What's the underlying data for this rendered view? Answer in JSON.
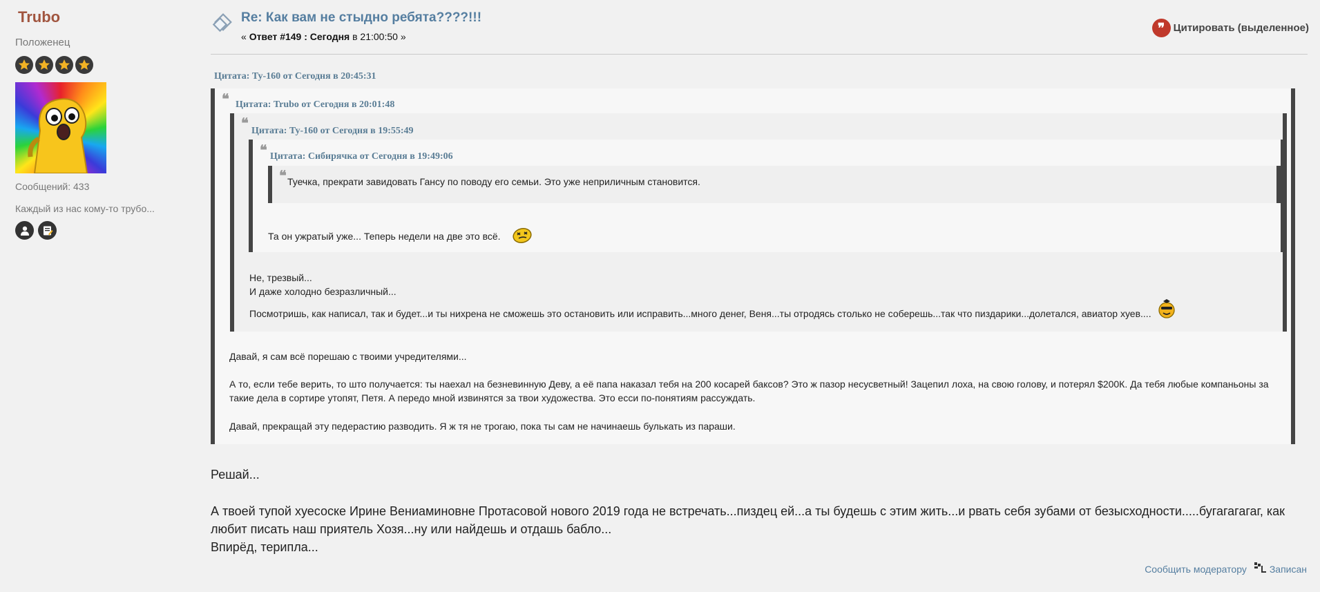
{
  "poster": {
    "name": "Trubo",
    "rank": "Положенец",
    "stars": 4,
    "posts": "Сообщений: 433",
    "personal_text": "Каждый из нас кому-то трубо..."
  },
  "post": {
    "title": "Re: Как вам не стыдно ребята????!!!",
    "meta_prefix": "« ",
    "meta_reply": "Ответ #149 : Сегодня",
    "meta_time": " в 21:00:50 »",
    "quote_button": "Цитировать (выделенное)"
  },
  "quotes": {
    "q1_header": "Цитата: Ту-160 от Сегодня в 20:45:31",
    "q2_header": "Цитата: Trubo от Сегодня в 20:01:48",
    "q3_header": "Цитата: Ту-160 от Сегодня в 19:55:49",
    "q4_header": "Цитата: Сибирячка от Сегодня в 19:49:06",
    "q4_text": "Туечка, прекрати завидовать Гансу по поводу его семьи. Это уже неприличным становится.",
    "q3_text": "Та он ужратый уже... Теперь недели на две это всё.",
    "q2_text_1": "Не, трезвый...",
    "q2_text_2": "И даже холодно безразличный...",
    "q2_text_3": "Посмотришь, как написал, так и будет...и ты нихрена не сможешь это остановить или исправить...много денег, Веня...ты отродясь столько не соберешь...так что пиздарики...долетался, авиатор хуев....",
    "q1_text_1": "Давай, я сам всё порешаю с твоими учредителями...",
    "q1_text_2": "А то, если тебе верить, то што получается: ты наехал на безневинную Деву, а её папа наказал тебя на 200 косарей баксов? Это ж пазор несусветный! Зацепил лоха, на свою голову, и потерял $200К.  Да тебя любые компаньоны за такие дела в сортире утопят, Петя. А передо мной извинятся за твои художества. Это есси по-понятиям рассуждать.",
    "q1_text_3": "Давай, прекращай эту педерастию разводить. Я ж тя не трогаю, пока ты сам не начинаешь булькать из параши."
  },
  "body": {
    "line_1": "Решай...",
    "line_2": "А твоей тупой хуесоске Ирине Вениаминовне Протасовой нового 2019 года не встречать...пиздец ей...а ты будешь с этим жить...и рвать себя зубами от безысходности.....бугагагагаг, как любит писать наш приятель Хозя...ну или найдешь и отдашь бабло...",
    "line_3": "Впирёд, терипла..."
  },
  "footer": {
    "report": "Сообщить модератору",
    "logged": "Записан"
  },
  "icons": {
    "post_icon": "message-diamond-icon",
    "quote": "quote-icon",
    "profile": "person-icon",
    "pm": "note-icon",
    "logged": "ip-log-icon"
  },
  "colors": {
    "username": "#a1553f",
    "title": "#557ea0",
    "quote_header": "#5a7d95",
    "quote_button_icon": "#c0392b",
    "quote_border": "#454545",
    "link": "#557ea0"
  }
}
